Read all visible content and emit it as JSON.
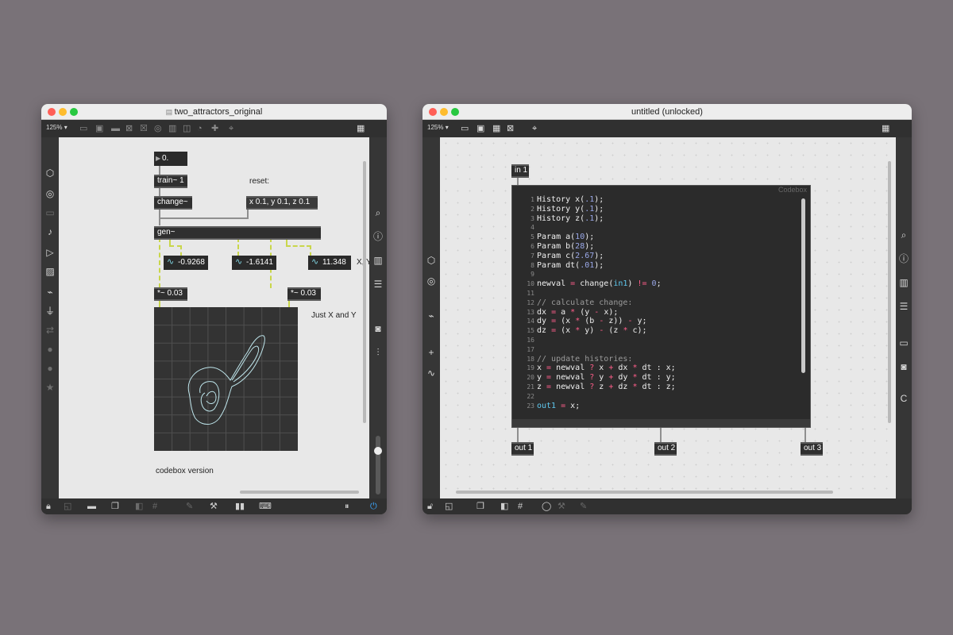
{
  "left_window": {
    "title": "two_attractors_original",
    "zoom": "125%",
    "objects": {
      "number_box": "0.",
      "train": "train~ 1",
      "change": "change~",
      "message": "x 0.1, y 0.1, z 0.1",
      "gen": "gen~",
      "mult1": "*~ 0.03",
      "mult2": "*~ 0.03"
    },
    "numbers": {
      "x": "-0.9268",
      "y": "-1.6141",
      "z": "11.348"
    },
    "comments": {
      "reset": "reset:",
      "xyz": "X, Y, Z",
      "just_xy": "Just X and Y",
      "codebox_version": "codebox version"
    }
  },
  "right_window": {
    "title": "untitled (unlocked)",
    "zoom": "125%",
    "inlet": "in 1",
    "codebox_label": "Codebox",
    "outlets": [
      "out 1",
      "out 2",
      "out 3"
    ],
    "code_lines": [
      {
        "n": "1",
        "t": "History x(.1);"
      },
      {
        "n": "2",
        "t": "History y(.1);"
      },
      {
        "n": "3",
        "t": "History z(.1);"
      },
      {
        "n": "4",
        "t": ""
      },
      {
        "n": "5",
        "t": "Param a(10);"
      },
      {
        "n": "6",
        "t": "Param b(28);"
      },
      {
        "n": "7",
        "t": "Param c(2.67);"
      },
      {
        "n": "8",
        "t": "Param dt(.01);"
      },
      {
        "n": "9",
        "t": ""
      },
      {
        "n": "10",
        "t": "newval = change(in1) != 0;"
      },
      {
        "n": "11",
        "t": ""
      },
      {
        "n": "12",
        "t": "// calculate change:"
      },
      {
        "n": "13",
        "t": "dx = a * (y - x);"
      },
      {
        "n": "14",
        "t": "dy = (x * (b - z)) - y;"
      },
      {
        "n": "15",
        "t": "dz = (x * y) - (z * c);"
      },
      {
        "n": "16",
        "t": ""
      },
      {
        "n": "17",
        "t": ""
      },
      {
        "n": "18",
        "t": "// update histories:"
      },
      {
        "n": "19",
        "t": "x = newval ? x + dx * dt : x;"
      },
      {
        "n": "20",
        "t": "y = newval ? y + dy * dt : y;"
      },
      {
        "n": "21",
        "t": "z = newval ? z + dz * dt : z;"
      },
      {
        "n": "22",
        "t": ""
      },
      {
        "n": "23",
        "t": "out1 = x;"
      }
    ]
  },
  "colors": {
    "desktop": "#797278",
    "cable": "#c9d64b",
    "signal_icon": "#7fd3e0"
  }
}
